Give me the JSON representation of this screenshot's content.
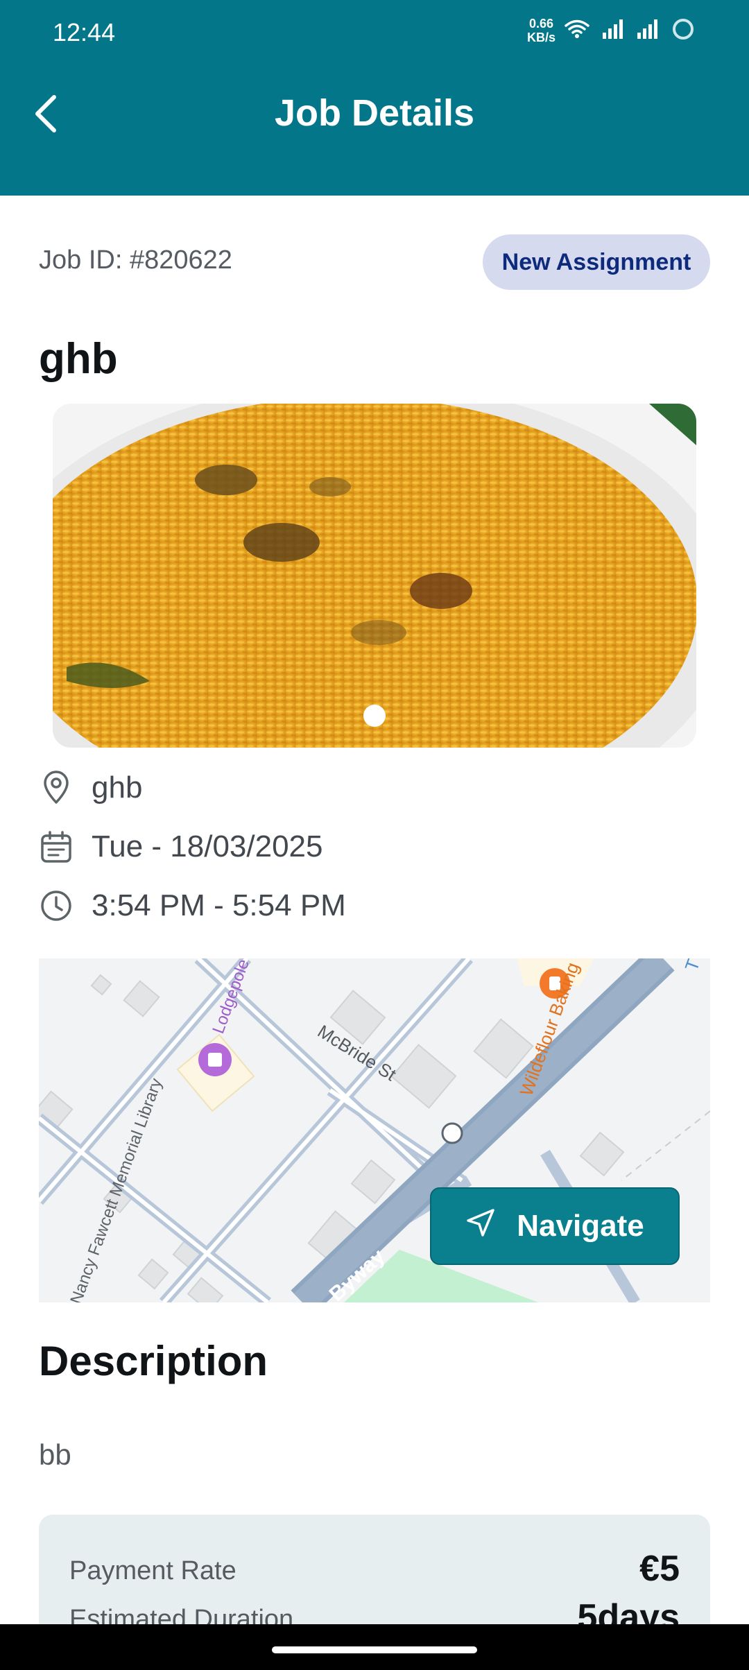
{
  "status_bar": {
    "time": "12:44",
    "speed_value": "0.66",
    "speed_unit": "KB/s",
    "icons": [
      "wifi-icon",
      "signal-icon",
      "signal-icon",
      "loading-ring-icon"
    ]
  },
  "header": {
    "title": "Job Details",
    "back_icon": "chevron-left-icon",
    "bg_color": "#037789"
  },
  "job": {
    "id_text": "Job ID: #820622",
    "badge": "New Assignment",
    "title": "ghb",
    "carousel": {
      "current": 1,
      "total": 1
    },
    "location": "ghb",
    "date": "Tue - 18/03/2025",
    "time": "3:54 PM - 5:54 PM"
  },
  "map": {
    "labels": {
      "street": "McBride St",
      "poi_bakery": "Wildeflour Baking Company",
      "library": "Nancy Fawcett Memorial Library",
      "community": "Lodgepole Community",
      "byway": "Byway",
      "corner": "T"
    },
    "navigate_label": "Navigate"
  },
  "description": {
    "heading": "Description",
    "text": "bb"
  },
  "payment": {
    "rate_label": "Payment Rate",
    "rate_value": "€5",
    "duration_label": "Estimated Duration",
    "duration_value": "5days"
  },
  "colors": {
    "primary": "#037789",
    "badge_bg": "#d5daee",
    "badge_text": "#0e2a7c",
    "card_bg": "#e6eef0"
  }
}
